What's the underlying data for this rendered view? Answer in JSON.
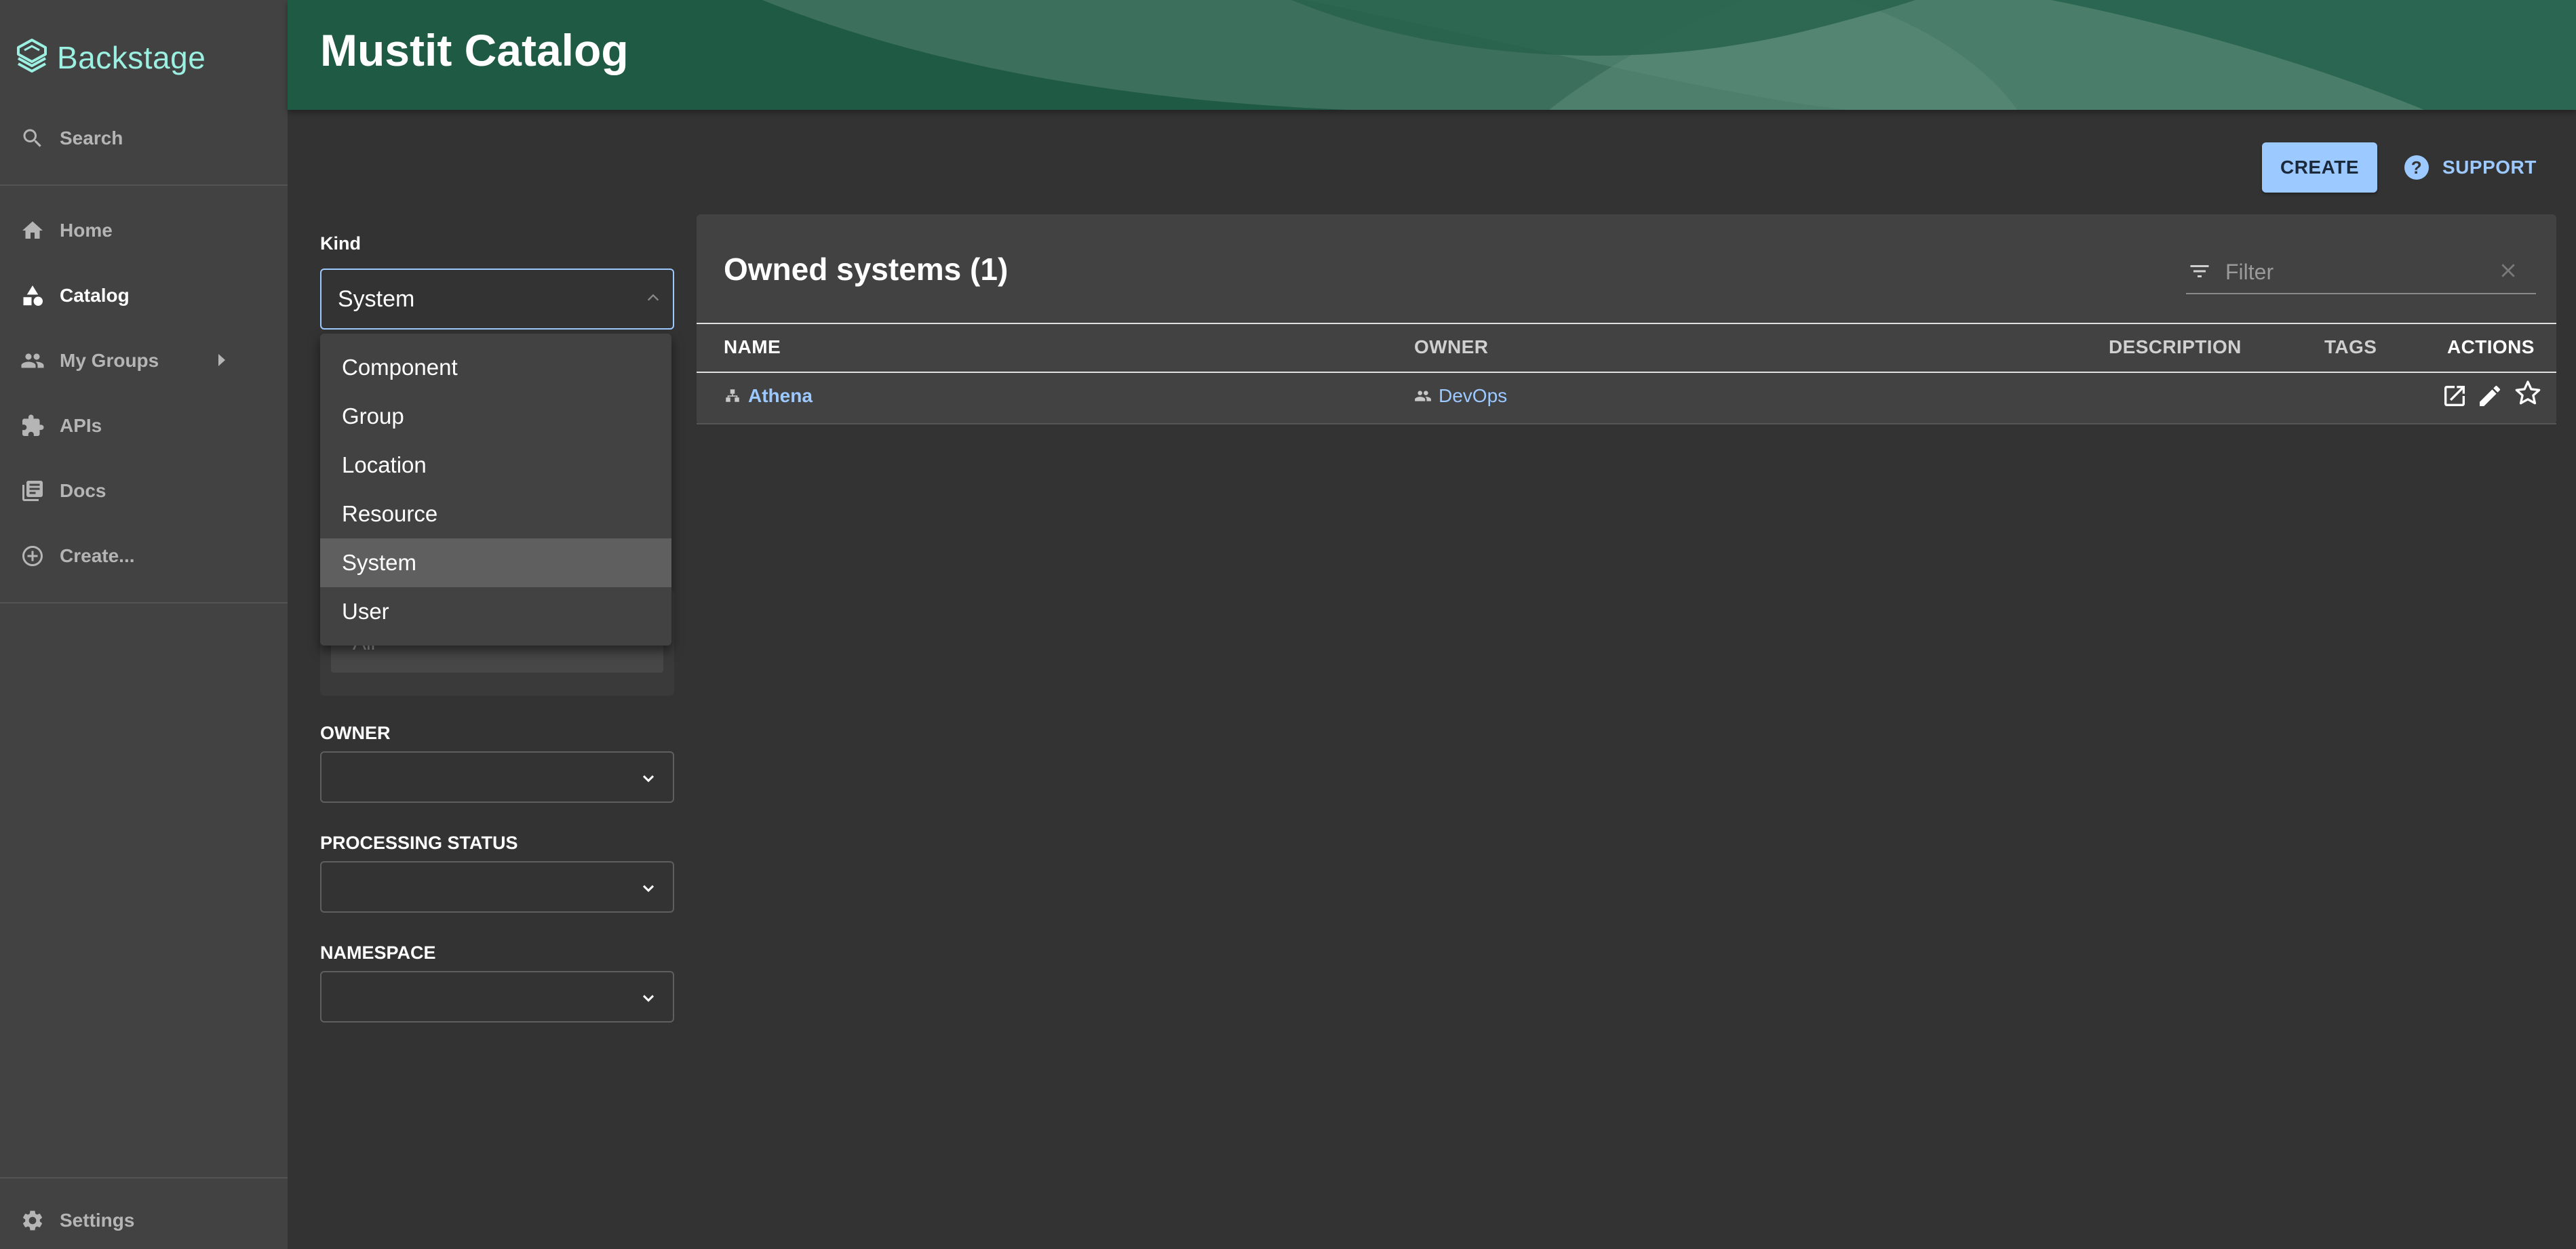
{
  "app": {
    "name": "Backstage"
  },
  "sidebar": {
    "items": [
      {
        "label": "Search",
        "icon": "search-icon"
      },
      {
        "label": "Home",
        "icon": "home-icon"
      },
      {
        "label": "Catalog",
        "icon": "catalog-icon",
        "active": true
      },
      {
        "label": "My Groups",
        "icon": "groups-icon"
      },
      {
        "label": "APIs",
        "icon": "puzzle-icon"
      },
      {
        "label": "Docs",
        "icon": "docs-icon"
      },
      {
        "label": "Create...",
        "icon": "add-circle-icon"
      }
    ],
    "settings_label": "Settings"
  },
  "header": {
    "title": "Mustit Catalog"
  },
  "actions": {
    "create_label": "CREATE",
    "support_label": "SUPPORT"
  },
  "filters": {
    "kind_label": "Kind",
    "kind_value": "System",
    "kind_options": [
      "Component",
      "Group",
      "Location",
      "Resource",
      "System",
      "User"
    ],
    "type_value": "All",
    "owner_label": "OWNER",
    "processing_status_label": "PROCESSING STATUS",
    "namespace_label": "NAMESPACE"
  },
  "table": {
    "title": "Owned systems (1)",
    "filter_placeholder": "Filter",
    "columns": [
      "NAME",
      "OWNER",
      "DESCRIPTION",
      "TAGS",
      "ACTIONS"
    ],
    "rows": [
      {
        "name": "Athena",
        "owner": "DevOps",
        "description": "",
        "tags": ""
      }
    ]
  },
  "colors": {
    "sidebar_bg": "#424242",
    "page_bg": "#333333",
    "header_bg": "#1f5a45",
    "accent": "#9cc9ff",
    "logo": "#9bf0e1"
  }
}
